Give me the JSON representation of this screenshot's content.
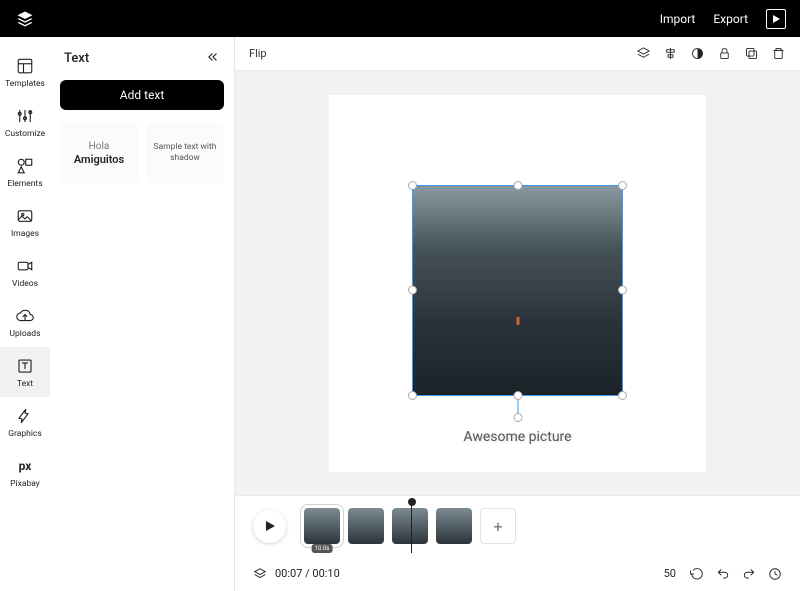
{
  "topbar": {
    "import": "Import",
    "export": "Export"
  },
  "nav": {
    "items": [
      {
        "key": "templates",
        "label": "Templates"
      },
      {
        "key": "customize",
        "label": "Customize"
      },
      {
        "key": "elements",
        "label": "Elements"
      },
      {
        "key": "images",
        "label": "Images"
      },
      {
        "key": "videos",
        "label": "Videos"
      },
      {
        "key": "uploads",
        "label": "Uploads"
      },
      {
        "key": "text",
        "label": "Text"
      },
      {
        "key": "graphics",
        "label": "Graphics"
      },
      {
        "key": "pixabay",
        "label": "Pixabay"
      }
    ]
  },
  "panel": {
    "title": "Text",
    "addTextBtn": "Add text",
    "preset1_line1": "Hola",
    "preset1_line2": "Amiguitos",
    "preset2_text": "Sample text with shadow"
  },
  "contextBar": {
    "flip": "Flip"
  },
  "canvas": {
    "caption": "Awesome picture"
  },
  "timeline": {
    "clipBadge": "10.0s",
    "addClip": "+"
  },
  "status": {
    "time": "00:07 / 00:10",
    "zoom": "50"
  }
}
